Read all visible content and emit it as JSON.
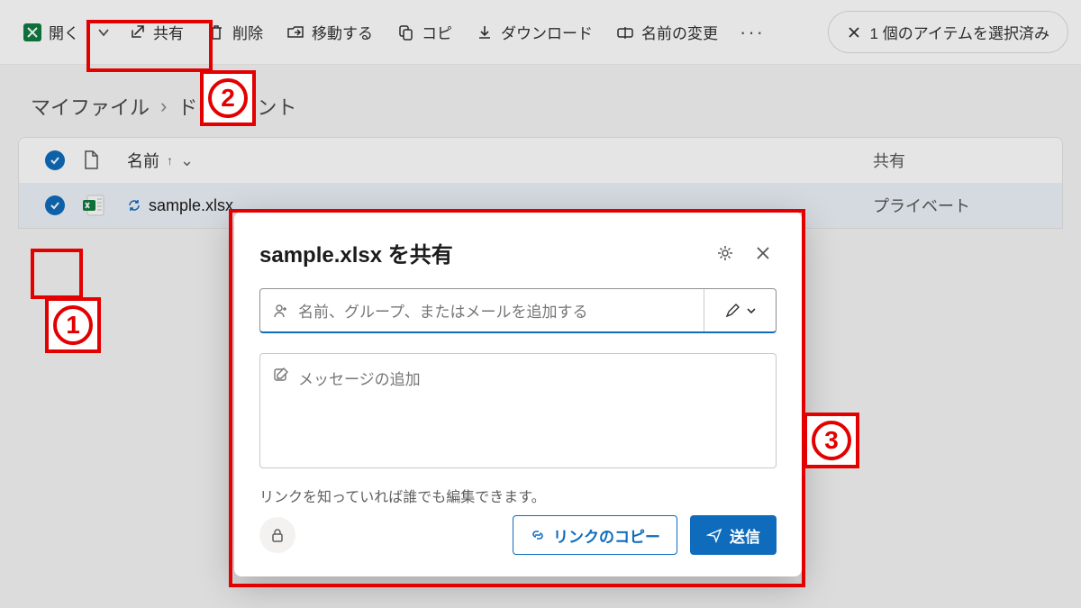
{
  "toolbar": {
    "open": "開く",
    "share": "共有",
    "delete": "削除",
    "move": "移動する",
    "copy": "コピ",
    "download": "ダウンロード",
    "rename": "名前の変更",
    "selection_text": "1 個のアイテムを選択済み"
  },
  "breadcrumb": {
    "root": "マイファイル",
    "current": "ドキュメント"
  },
  "list": {
    "header_name": "名前",
    "header_share": "共有",
    "file_name": "sample.xlsx",
    "file_share": "プライベート"
  },
  "modal": {
    "title": "sample.xlsx を共有",
    "recipients_placeholder": "名前、グループ、またはメールを追加する",
    "message_placeholder": "メッセージの追加",
    "link_note": "リンクを知っていれば誰でも編集できます。",
    "copy_link": "リンクのコピー",
    "send": "送信"
  },
  "annotations": {
    "one": "1",
    "two": "2",
    "three": "3"
  }
}
